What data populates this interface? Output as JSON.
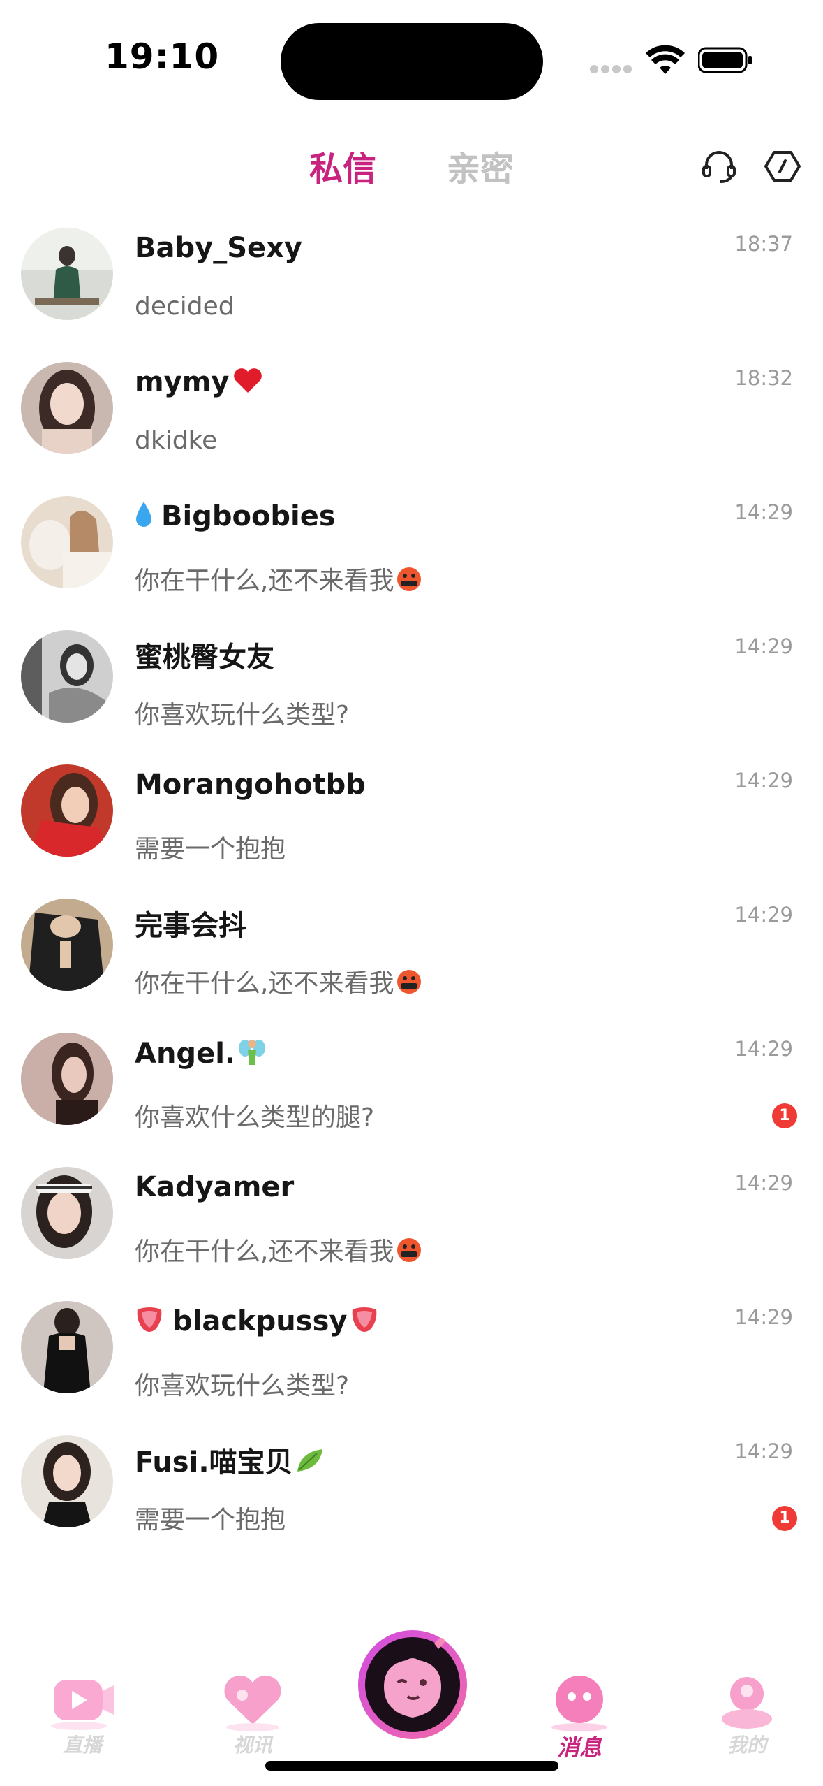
{
  "status_bar": {
    "time": "19:10"
  },
  "header": {
    "tabs": [
      {
        "label": "私信",
        "active": true
      },
      {
        "label": "亲密",
        "active": false
      }
    ],
    "icons": [
      "headset-icon",
      "broom-icon"
    ]
  },
  "conversations": [
    {
      "name": "Baby_Sexy",
      "name_emoji": "",
      "message": "decided",
      "message_emoji": "",
      "time": "18:37",
      "unread": null
    },
    {
      "name": "mymy",
      "name_emoji": "heart-icon",
      "message": "dkidke",
      "message_emoji": "",
      "time": "18:32",
      "unread": null
    },
    {
      "name": "Bigboobies",
      "name_emoji": "droplet-icon",
      "message": "你在干什么,还不来看我",
      "message_emoji": "angry-face-icon",
      "time": "14:29",
      "unread": null
    },
    {
      "name": "蜜桃臀女友",
      "name_emoji": "",
      "message": "你喜欢玩什么类型?",
      "message_emoji": "",
      "time": "14:29",
      "unread": null
    },
    {
      "name": "Morangohotbb",
      "name_emoji": "",
      "message": "需要一个抱抱",
      "message_emoji": "",
      "time": "14:29",
      "unread": null
    },
    {
      "name": "完事会抖",
      "name_emoji": "",
      "message": "你在干什么,还不来看我",
      "message_emoji": "angry-face-icon",
      "time": "14:29",
      "unread": null
    },
    {
      "name": "Angel.",
      "name_emoji": "fairy-icon",
      "message": "你喜欢什么类型的腿?",
      "message_emoji": "",
      "time": "14:29",
      "unread": "1"
    },
    {
      "name": "Kadyamer",
      "name_emoji": "",
      "message": "你在干什么,还不来看我",
      "message_emoji": "angry-face-icon",
      "time": "14:29",
      "unread": null
    },
    {
      "name": "blackpussy",
      "name_emoji": "tongue-icon",
      "message": "你喜欢玩什么类型?",
      "message_emoji": "",
      "time": "14:29",
      "unread": null
    },
    {
      "name": "Fusi.喵宝贝",
      "name_emoji": "leaf-icon",
      "message": "需要一个抱抱",
      "message_emoji": "",
      "time": "14:29",
      "unread": "1"
    }
  ],
  "bottom_nav": [
    {
      "label": "直播",
      "icon": "live-icon",
      "active": false
    },
    {
      "label": "视讯",
      "icon": "video-chat-icon",
      "active": false
    },
    {
      "label": "",
      "icon": "peach-mascot-icon",
      "active": false
    },
    {
      "label": "消息",
      "icon": "message-icon",
      "active": true
    },
    {
      "label": "我的",
      "icon": "profile-icon",
      "active": false
    }
  ],
  "colors": {
    "accent": "#c8237f",
    "inactive_tab": "#c2c2c2",
    "badge": "#f03a35",
    "pink": "#f7a7cf"
  }
}
